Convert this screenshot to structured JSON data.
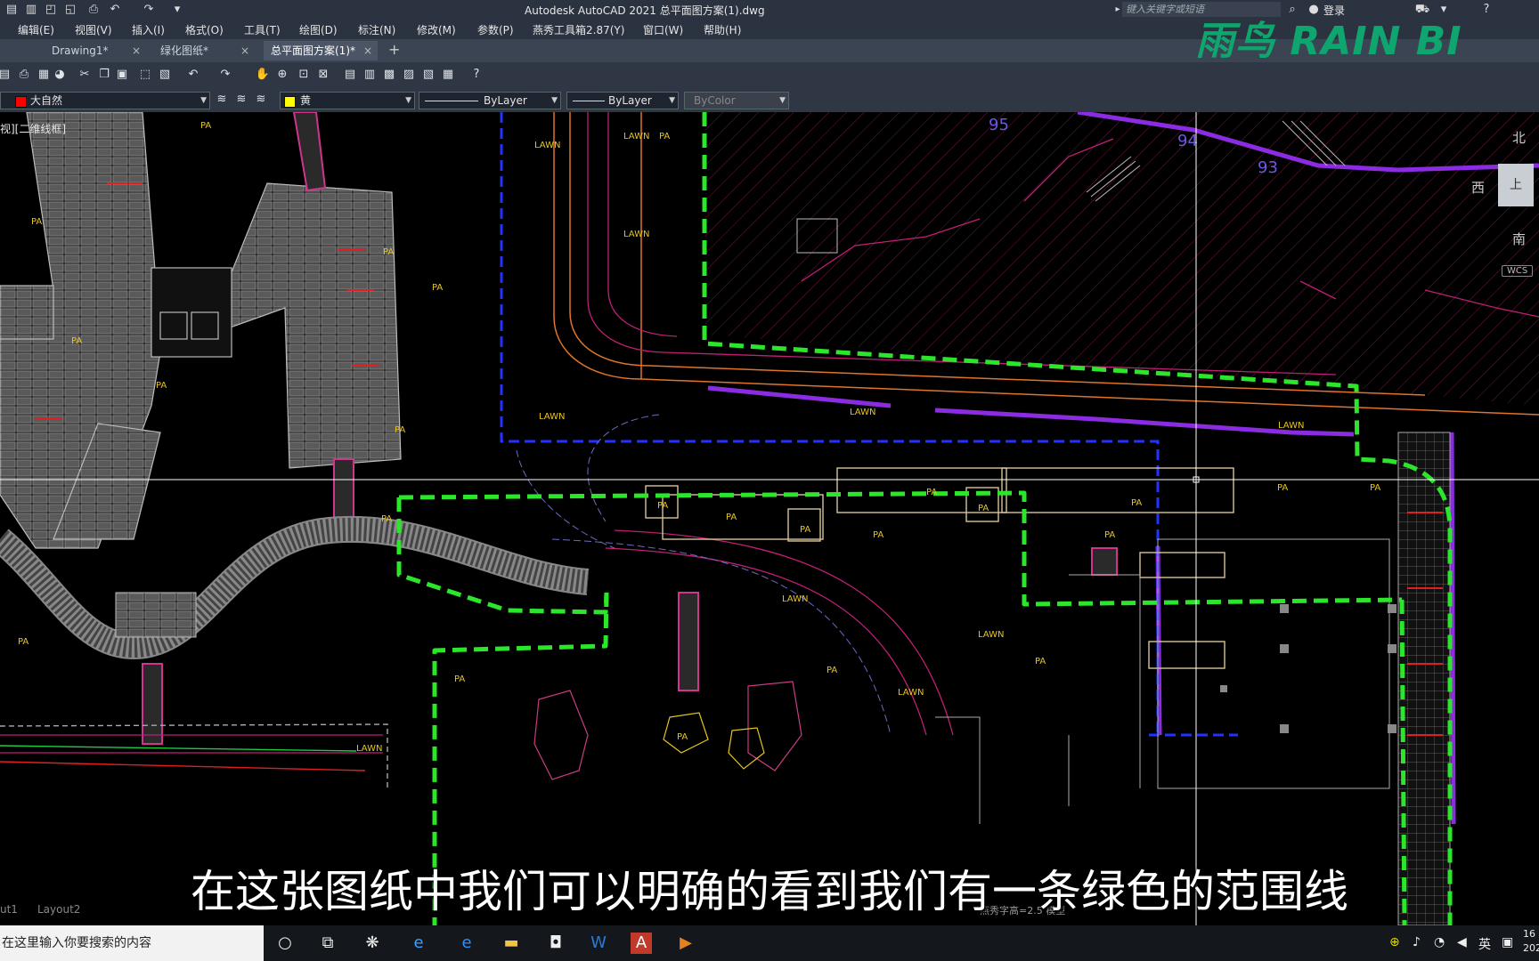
{
  "app": {
    "title": "Autodesk AutoCAD 2021   总平面图方案(1).dwg",
    "search_placeholder": "键入关键字或短语",
    "login": "登录"
  },
  "menu": [
    "编辑(E)",
    "视图(V)",
    "插入(I)",
    "格式(O)",
    "工具(T)",
    "绘图(D)",
    "标注(N)",
    "修改(M)",
    "参数(P)",
    "燕秀工具箱2.87(Y)",
    "窗口(W)",
    "帮助(H)"
  ],
  "tabs": [
    {
      "label": "Drawing1*",
      "close": "×"
    },
    {
      "label": "绿化图纸*",
      "close": "×"
    },
    {
      "label": "总平面图方案(1)*",
      "close": "×"
    }
  ],
  "tab_add": "+",
  "properties": {
    "layer": "大自然",
    "layer_color": "#ff0000",
    "color": "黄",
    "color_swatch": "#ffff00",
    "linetype": "ByLayer",
    "lineweight": "ByLayer",
    "plotstyle": "ByColor"
  },
  "viewport_label": "视][二维线框]",
  "logo": "雨鸟 RAIN BI",
  "compass": {
    "north": "北",
    "west": "西",
    "south": "南",
    "top": "上",
    "wcs": "WCS"
  },
  "drawing_labels": {
    "pa": "PA",
    "lawn": "LAWN",
    "contour_95": "95",
    "contour_94": "94",
    "contour_93": "93"
  },
  "subtitle": "在这张图纸中我们可以明确的看到我们有一条绿色的范围线",
  "layout_tabs": [
    "ut1",
    "Layout2"
  ],
  "status_bar": "燕秀字高=2.5   模型",
  "taskbar": {
    "search_placeholder": "在这里输入你要搜索的内容",
    "ime": "英",
    "clock_line1": "16",
    "clock_line2": "202"
  },
  "colors": {
    "boundary_green": "#2ce62c",
    "road_magenta": "#c11f76",
    "purple_line": "#8b2be2",
    "yellow_label": "#e8c51c"
  }
}
